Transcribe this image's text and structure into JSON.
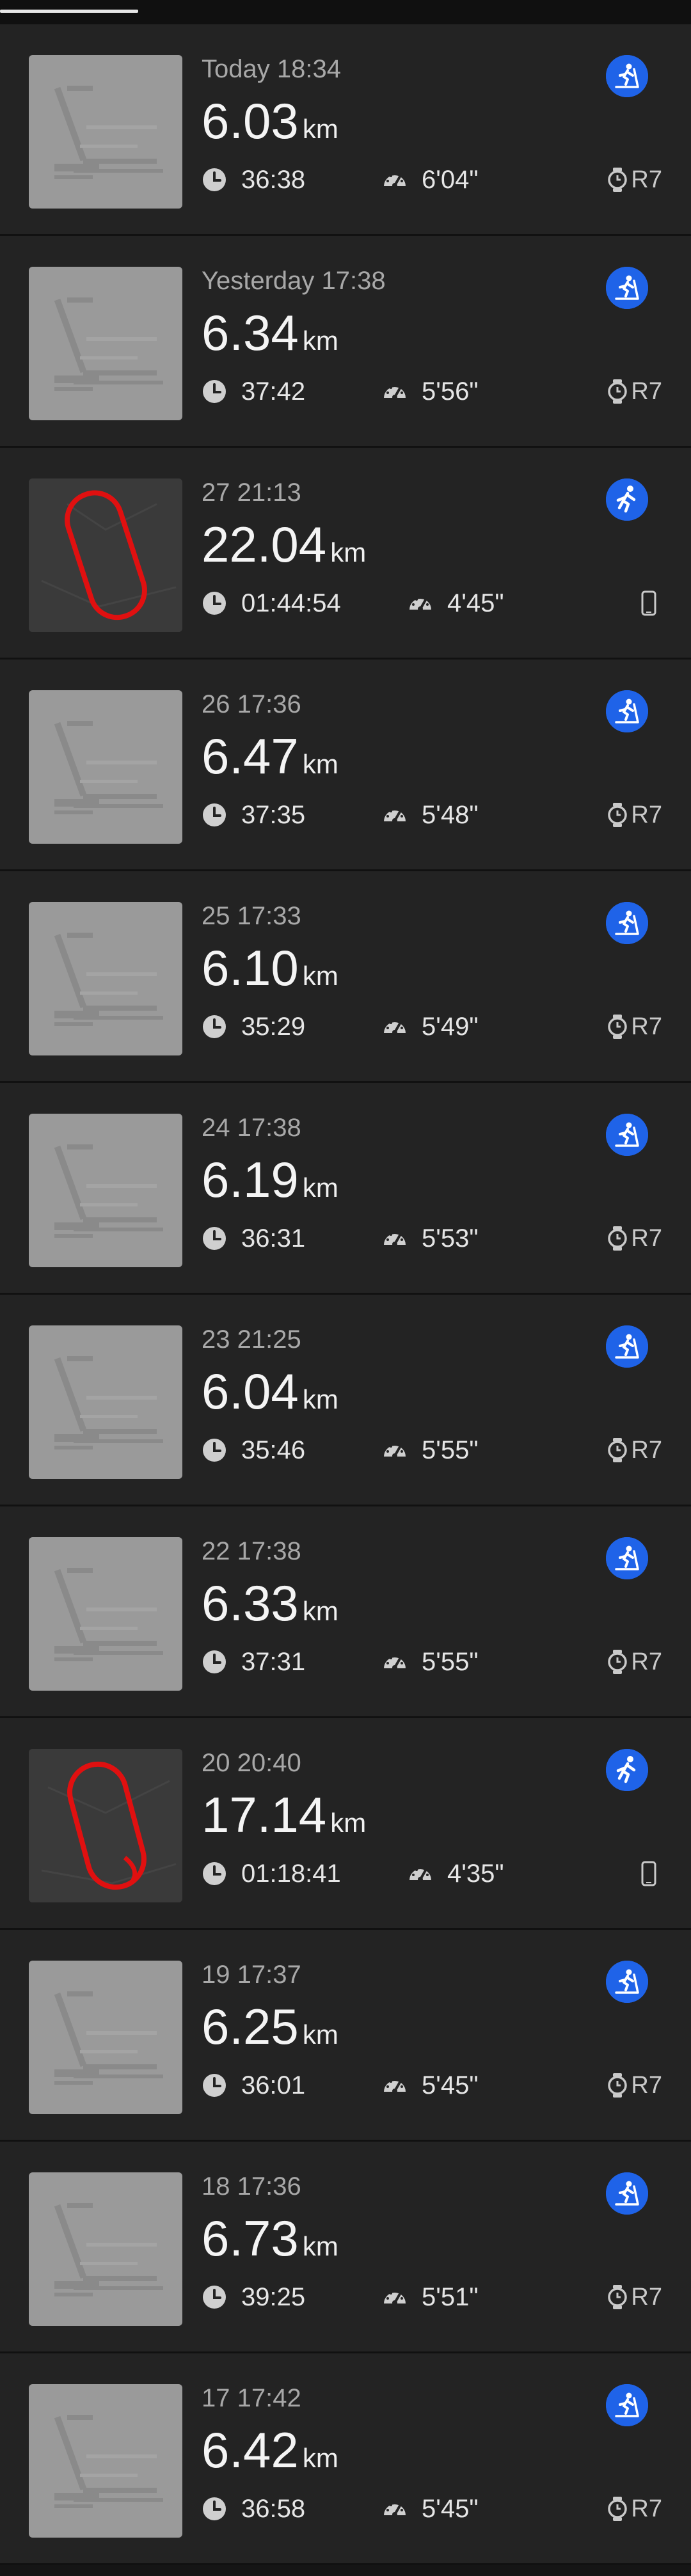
{
  "activities": [
    {
      "date": "Today 18:34",
      "distance": "6.03",
      "unit": "km",
      "duration": "36:38",
      "pace": "6'04\"",
      "type": "treadmill",
      "device": "R7"
    },
    {
      "date": "Yesterday 17:38",
      "distance": "6.34",
      "unit": "km",
      "duration": "37:42",
      "pace": "5'56\"",
      "type": "treadmill",
      "device": "R7"
    },
    {
      "date": "27 21:13",
      "distance": "22.04",
      "unit": "km",
      "duration": "01:44:54",
      "pace": "4'45\"",
      "type": "outdoor-run",
      "device": ""
    },
    {
      "date": "26 17:36",
      "distance": "6.47",
      "unit": "km",
      "duration": "37:35",
      "pace": "5'48\"",
      "type": "treadmill",
      "device": "R7"
    },
    {
      "date": "25 17:33",
      "distance": "6.10",
      "unit": "km",
      "duration": "35:29",
      "pace": "5'49\"",
      "type": "treadmill",
      "device": "R7"
    },
    {
      "date": "24 17:38",
      "distance": "6.19",
      "unit": "km",
      "duration": "36:31",
      "pace": "5'53\"",
      "type": "treadmill",
      "device": "R7"
    },
    {
      "date": "23 21:25",
      "distance": "6.04",
      "unit": "km",
      "duration": "35:46",
      "pace": "5'55\"",
      "type": "treadmill",
      "device": "R7"
    },
    {
      "date": "22 17:38",
      "distance": "6.33",
      "unit": "km",
      "duration": "37:31",
      "pace": "5'55\"",
      "type": "treadmill",
      "device": "R7"
    },
    {
      "date": "20 20:40",
      "distance": "17.14",
      "unit": "km",
      "duration": "01:18:41",
      "pace": "4'35\"",
      "type": "outdoor-run",
      "device": ""
    },
    {
      "date": "19 17:37",
      "distance": "6.25",
      "unit": "km",
      "duration": "36:01",
      "pace": "5'45\"",
      "type": "treadmill",
      "device": "R7"
    },
    {
      "date": "18 17:36",
      "distance": "6.73",
      "unit": "km",
      "duration": "39:25",
      "pace": "5'51\"",
      "type": "treadmill",
      "device": "R7"
    },
    {
      "date": "17 17:42",
      "distance": "6.42",
      "unit": "km",
      "duration": "36:58",
      "pace": "5'45\"",
      "type": "treadmill",
      "device": "R7"
    }
  ],
  "colors": {
    "accent": "#1f63e8",
    "route": "#e01010",
    "background": "#232323"
  },
  "icons": {
    "duration": "clock-icon",
    "pace": "speedometer-icon",
    "treadmill_sport": "treadmill-run-icon",
    "outdoor_sport": "outdoor-run-icon",
    "watch": "watch-icon",
    "phone": "phone-icon"
  }
}
